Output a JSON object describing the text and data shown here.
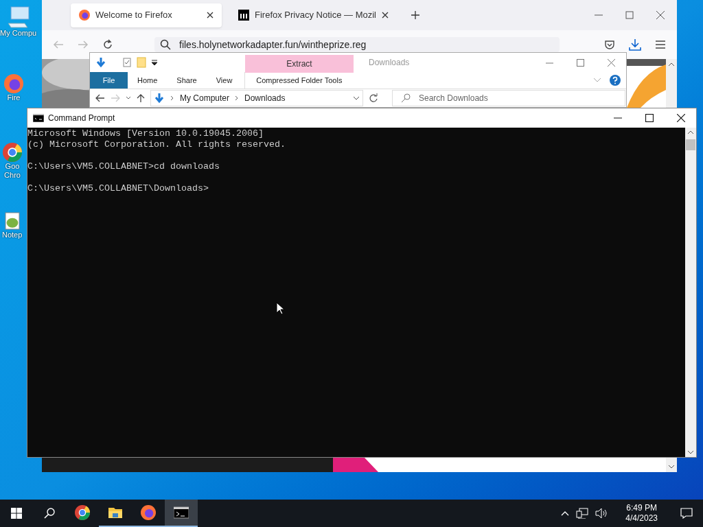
{
  "desktop_icons": [
    {
      "kind": "computer",
      "label": "My Compu"
    },
    {
      "kind": "firefox",
      "label": "Fire"
    },
    {
      "kind": "chrome",
      "label": "Goo\nChro"
    },
    {
      "kind": "notepad",
      "label": "Notep"
    }
  ],
  "browser": {
    "tabs": [
      {
        "kind": "firefox",
        "title": "Welcome to Firefox",
        "selected": true
      },
      {
        "kind": "mozilla",
        "title": "Firefox Privacy Notice — Mozil",
        "selected": false
      }
    ],
    "url": "files.holynetworkadapter.fun/wintheprize.reg"
  },
  "explorer": {
    "context_tab": "Extract",
    "title": "Downloads",
    "tabs": [
      {
        "label": "File",
        "kind": "file"
      },
      {
        "label": "Home",
        "kind": "normal"
      },
      {
        "label": "Share",
        "kind": "normal"
      },
      {
        "label": "View",
        "kind": "normal"
      },
      {
        "label": "Compressed Folder Tools",
        "kind": "contextual"
      }
    ],
    "breadcrumb": [
      "My Computer",
      "Downloads"
    ],
    "search": {
      "placeholder": "Search Downloads"
    }
  },
  "cmd": {
    "title": "Command Prompt",
    "blocks": [
      [
        "Microsoft Windows [Version 10.0.19045.2006]",
        "(c) Microsoft Corporation. All rights reserved."
      ],
      [
        "C:\\Users\\VM5.COLLABNET>cd downloads"
      ],
      [
        "C:\\Users\\VM5.COLLABNET\\Downloads>"
      ]
    ]
  },
  "taskbar": {
    "apps": [
      {
        "kind": "chrome",
        "running": false,
        "selected": false
      },
      {
        "kind": "explorer",
        "running": true,
        "selected": false
      },
      {
        "kind": "firefox",
        "running": true,
        "selected": false
      },
      {
        "kind": "cmd",
        "running": true,
        "selected": true
      }
    ],
    "clock": {
      "time": "6:49 PM",
      "date": "4/4/2023"
    }
  }
}
